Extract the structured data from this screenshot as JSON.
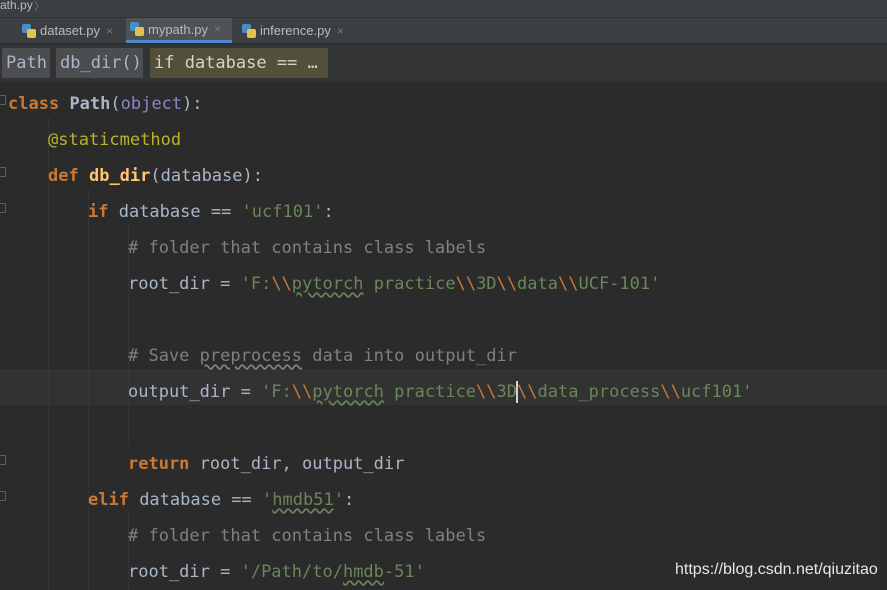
{
  "top_crumb": {
    "file": "ath.py",
    "sep": "〉"
  },
  "tabs": {
    "lead_close": "×",
    "items": [
      {
        "label": "dataset.py",
        "close": "×",
        "icon": "python-file-icon"
      },
      {
        "label": "mypath.py",
        "close": "×",
        "icon": "python-file-icon",
        "active": true
      },
      {
        "label": "inference.py",
        "close": "×",
        "icon": "python-file-icon"
      }
    ]
  },
  "breadcrumbs": [
    "Path",
    "db_dir()",
    "if database == …"
  ],
  "code": {
    "l1": {
      "kw": "class",
      "name": "Path",
      "open": "(",
      "base": "object",
      "close": "):"
    },
    "l2": {
      "decorator": "@staticmethod"
    },
    "l3": {
      "kw": "def",
      "name": "db_dir",
      "params": "(database):"
    },
    "l4": {
      "kw": "if",
      "rest": " database == ",
      "str": "'ucf101'",
      "end": ":"
    },
    "l5": {
      "comment": "# folder that contains class labels"
    },
    "l6": {
      "lhs": "root_dir = ",
      "s1": "'F:",
      "e1": "\\\\",
      "s2": "pytorch",
      "s3": " practice",
      "e2": "\\\\",
      "s4": "3D",
      "e3": "\\\\",
      "s5": "data",
      "e4": "\\\\",
      "s6": "UCF-101'"
    },
    "l8": {
      "c1": "# Save ",
      "c2": "preprocess",
      "c3": " data into output_dir"
    },
    "l9": {
      "lhs": "output_dir = ",
      "s1": "'F:",
      "e1": "\\\\",
      "s2": "pytorch",
      "s3": " practice",
      "e2": "\\\\",
      "s4": "3D",
      "e3": "\\\\",
      "s5": "data_process",
      "e4": "\\\\",
      "s6": "ucf101'"
    },
    "l11": {
      "kw": "return",
      "rest": " root_dir, output_dir"
    },
    "l12": {
      "kw": "elif",
      "rest": " database == ",
      "s1": "'",
      "s2": "hmdb51",
      "s3": "'",
      "end": ":"
    },
    "l13": {
      "comment": "# folder that contains class labels"
    },
    "l14": {
      "lhs": "root_dir = ",
      "s1": "'/Path/to/",
      "s2": "hmdb",
      "s3": "-51'"
    }
  },
  "watermark": "https://blog.csdn.net/qiuzitao",
  "colors": {
    "background": "#2b2b2b",
    "keyword": "#cc7832",
    "string": "#6a8759",
    "comment": "#808080",
    "decorator": "#bbb529",
    "function": "#ffc66d",
    "builtin": "#8888c6",
    "active_tab_underline": "#4a88c7"
  }
}
